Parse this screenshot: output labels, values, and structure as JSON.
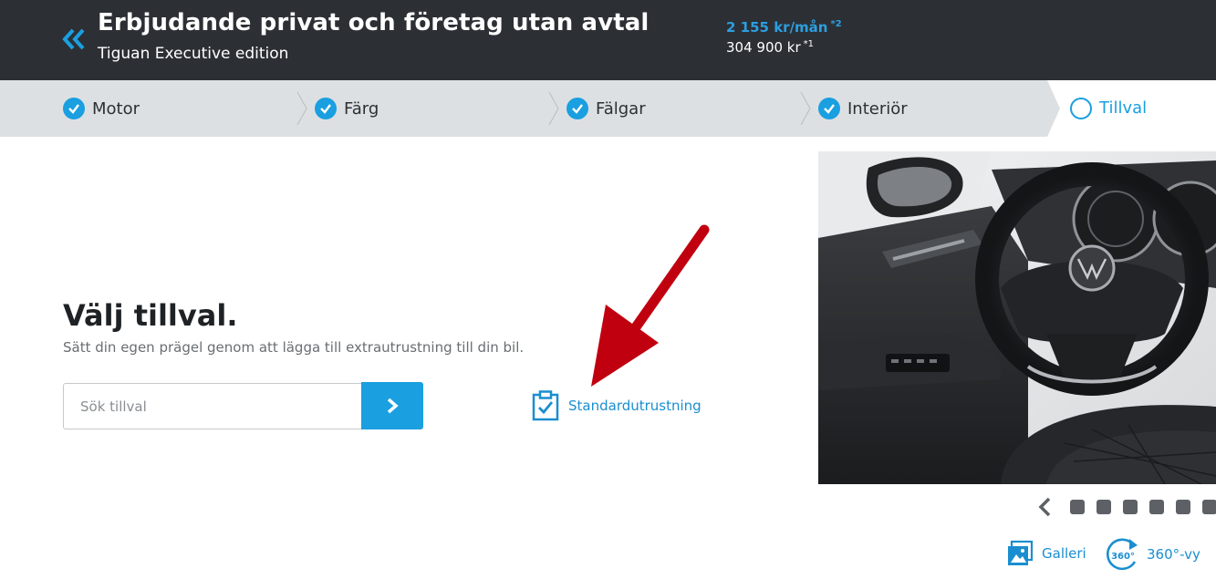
{
  "header": {
    "title": "Erbjudande privat och företag utan avtal",
    "subtitle": "Tiguan Executive edition",
    "price_month": "2 155 kr/mån",
    "price_month_note": "*2",
    "price_total": "304 900 kr",
    "price_total_note": "*1"
  },
  "steps": [
    {
      "label": "Motor",
      "done": true
    },
    {
      "label": "Färg",
      "done": true
    },
    {
      "label": "Fälgar",
      "done": true
    },
    {
      "label": "Interiör",
      "done": true
    },
    {
      "label": "Tillval",
      "done": false,
      "active": true
    }
  ],
  "main": {
    "heading": "Välj tillval.",
    "intro": "Sätt din egen prägel genom att lägga till extrautrustning till din bil.",
    "search_placeholder": "Sök tillval",
    "standard_equipment_label": "Standardutrustning"
  },
  "media": {
    "gallery_label": "Galleri",
    "view360_label": "360°-vy",
    "view360_badge": "360°"
  },
  "colors": {
    "accent": "#1a9fe0",
    "header_bg": "#2c3035",
    "steps_bg": "#dde0e2",
    "annotation_arrow": "#c0000f"
  }
}
